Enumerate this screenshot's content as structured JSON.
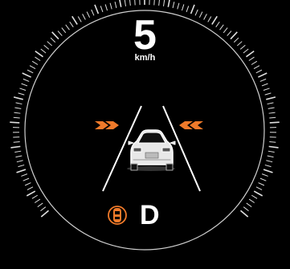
{
  "speedometer": {
    "speed": "5",
    "unit": "km/h"
  },
  "drive": {
    "gear": "D"
  },
  "icons": {
    "left_alert": "double-chevron-right-icon",
    "right_alert": "double-chevron-left-icon",
    "vehicle": "car-rear-icon",
    "status": "parking-sensor-car-icon"
  },
  "colors": {
    "background": "#000000",
    "foreground": "#ffffff",
    "alert": "#f07a2a"
  }
}
